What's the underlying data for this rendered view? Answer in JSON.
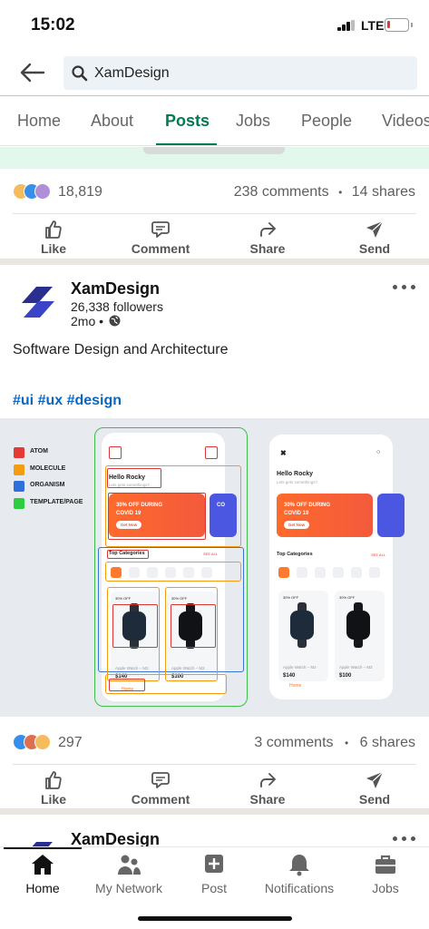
{
  "status_bar": {
    "time": "15:02",
    "network": "LTE",
    "battery_level": 0.15
  },
  "search": {
    "value": "XamDesign",
    "placeholder": ""
  },
  "tabs": [
    {
      "label": "Home",
      "active": false
    },
    {
      "label": "About",
      "active": false
    },
    {
      "label": "Posts",
      "active": true
    },
    {
      "label": "Jobs",
      "active": false
    },
    {
      "label": "People",
      "active": false
    },
    {
      "label": "Videos",
      "active": false
    }
  ],
  "post1": {
    "reaction_count": "18,819",
    "comments": "238 comments",
    "shares": "14 shares",
    "separator": "•"
  },
  "actions": {
    "like": "Like",
    "comment": "Comment",
    "share": "Share",
    "send": "Send"
  },
  "post2": {
    "author": "XamDesign",
    "followers": "26,338 followers",
    "age": "2mo •",
    "text": "Software Design and Architecture",
    "tags": "#ui #ux #design",
    "reaction_count": "297",
    "comments": "3 comments",
    "shares": "6 shares",
    "separator": "•"
  },
  "image": {
    "legend": [
      {
        "label": "ATOM",
        "color": "#e53935"
      },
      {
        "label": "MOLECULE",
        "color": "#f39c12"
      },
      {
        "label": "ORGANISM",
        "color": "#2f6fdb"
      },
      {
        "label": "TEMPLATE/PAGE",
        "color": "#2ecc40"
      }
    ],
    "greeting": "Hello Rocky",
    "subgreeting": "Lets gets somethings?",
    "banner_line1": "30% OFF DURING",
    "banner_line2": "COVID 19",
    "banner_button": "Get Now",
    "banner_peek": "CO",
    "categories_title": "Top Categories",
    "see_all": "SEE ALL",
    "discount": "30% OFF",
    "product_name_1": "Apple Watch – M2",
    "product_name_2": "Apple Watch – M2",
    "price_1": "$140",
    "old_price_1": "$160",
    "price_2": "$100",
    "old_price_2": "$150",
    "nav_home": "Home"
  },
  "post3": {
    "author": "XamDesign"
  },
  "bottom_nav": [
    {
      "label": "Home",
      "active": true
    },
    {
      "label": "My Network",
      "active": false
    },
    {
      "label": "Post",
      "active": false
    },
    {
      "label": "Notifications",
      "active": false
    },
    {
      "label": "Jobs",
      "active": false
    }
  ],
  "colors": {
    "accent": "#047a55",
    "link": "#0a66c2"
  }
}
